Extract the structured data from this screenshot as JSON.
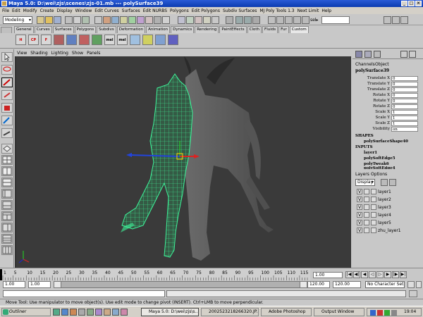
{
  "window": {
    "title": "Maya 5.0: D:\\wei\\zjs\\scenes\\zjs-01.mb  ---  polySurface39",
    "controls": [
      "_",
      "□",
      "×"
    ]
  },
  "menubar": [
    "File",
    "Edit",
    "Modify",
    "Create",
    "Display",
    "Window",
    "Edit Curves",
    "Surfaces",
    "Edit NURBS",
    "Polygons",
    "Edit Polygons",
    "Subdiv Surfaces",
    "MJ Poly Tools 1.3",
    "Next Limit",
    "Help"
  ],
  "statusline": {
    "mode": "Modeling",
    "sel_label": "sel▸",
    "sel_value": ""
  },
  "shelf_tabs": [
    "General",
    "Curves",
    "Surfaces",
    "Polygons",
    "Subdivs",
    "Deformation",
    "Animation",
    "Dynamics",
    "Rendering",
    "PaintEffects",
    "Cloth",
    "Fluids",
    "Fur",
    "Custom"
  ],
  "shelf_active": "Custom",
  "shelf_icons": [
    "H",
    "CP",
    "F",
    "",
    "",
    "",
    "",
    "",
    "",
    "mel",
    "mel",
    "",
    "",
    "",
    "",
    ""
  ],
  "viewport_menu": [
    "View",
    "Shading",
    "Lighting",
    "Show",
    "Panels"
  ],
  "channel_box": {
    "tabs": [
      "Channels",
      "Object"
    ],
    "object": "polySurface39",
    "channels": [
      {
        "name": "Translate X",
        "value": "0"
      },
      {
        "name": "Translate Y",
        "value": "0"
      },
      {
        "name": "Translate Z",
        "value": "0"
      },
      {
        "name": "Rotate X",
        "value": "0"
      },
      {
        "name": "Rotate Y",
        "value": "0"
      },
      {
        "name": "Rotate Z",
        "value": "0"
      },
      {
        "name": "Scale X",
        "value": "1"
      },
      {
        "name": "Scale Y",
        "value": "1"
      },
      {
        "name": "Scale Z",
        "value": "1"
      },
      {
        "name": "Visibility",
        "value": "on"
      }
    ],
    "shapes_header": "SHAPES",
    "shape": "polySurfaceShape40",
    "inputs_header": "INPUTS",
    "inputs": [
      "layer1",
      "polySoftEdge5",
      "polyTweak6",
      "polySoftEdge4"
    ]
  },
  "layers": {
    "tabs": [
      "Layers",
      "Options"
    ],
    "display": "Display",
    "items": [
      {
        "v": "V",
        "name": "layer1"
      },
      {
        "v": "V",
        "name": "layer2"
      },
      {
        "v": "V",
        "name": "layer3"
      },
      {
        "v": "V",
        "name": "layer4"
      },
      {
        "v": "V",
        "name": "layer5"
      },
      {
        "v": "V",
        "name": "zhu_layer1"
      }
    ]
  },
  "timeline": {
    "ticks": [
      "1",
      "5",
      "10",
      "15",
      "20",
      "25",
      "30",
      "35",
      "40",
      "45",
      "50",
      "55",
      "60",
      "65",
      "70",
      "75",
      "80",
      "85",
      "90",
      "95",
      "100",
      "105",
      "110",
      "115"
    ],
    "current": "1.00"
  },
  "range": {
    "start": "1.00",
    "start2": "1.00",
    "end": "120.00",
    "end2": "120.00",
    "char_set": "No Character Set"
  },
  "help_line": "Move Tool: Use manipulator to move object(s). Use edit mode to change pivot (INSERT). Ctrl+LMB to move perpendicular.",
  "taskbar": {
    "start_label": "Outliner",
    "tasks": [
      "Maya 5.0: D:\\wei\\zjs\\s...",
      "2002523218266320.JP...",
      "Adobe Photoshop",
      "Output Window"
    ],
    "clock": "19:04"
  }
}
